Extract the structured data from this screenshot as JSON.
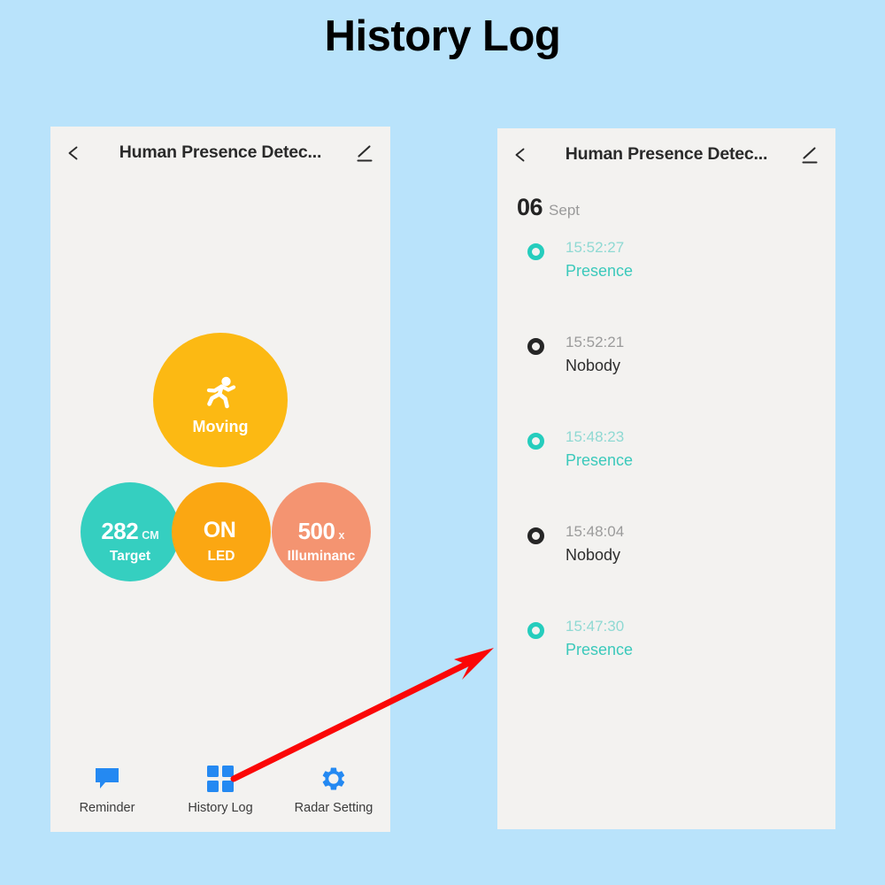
{
  "page": {
    "title": "History Log",
    "background_color": "#b9e3fb"
  },
  "left_phone": {
    "appbar": {
      "back_icon": "chevron-left-icon",
      "title": "Human Presence Detec...",
      "edit_icon": "pencil-edit-icon"
    },
    "status": {
      "icon": "running-person-icon",
      "label": "Moving",
      "color": "#fcb913"
    },
    "metrics": [
      {
        "value": "282",
        "unit": "CM",
        "name": "Target",
        "color": "#35cfc0"
      },
      {
        "value": "ON",
        "unit": "",
        "name": "LED",
        "color": "#fba712"
      },
      {
        "value": "500",
        "unit": "x",
        "name": "Illuminanc",
        "color": "#f49471"
      }
    ],
    "bottom_nav": [
      {
        "icon": "speech-bubble-icon",
        "label": "Reminder"
      },
      {
        "icon": "grid-squares-icon",
        "label": "History Log"
      },
      {
        "icon": "gear-icon",
        "label": "Radar Setting"
      }
    ],
    "nav_icon_color": "#2489f2"
  },
  "right_phone": {
    "appbar": {
      "back_icon": "chevron-left-icon",
      "title": "Human Presence Detec...",
      "edit_icon": "pencil-edit-icon"
    },
    "date": {
      "day": "06",
      "month": "Sept"
    },
    "log_entries": [
      {
        "time": "15:52:27",
        "state": "Presence",
        "type": "presence"
      },
      {
        "time": "15:52:21",
        "state": "Nobody",
        "type": "nobody"
      },
      {
        "time": "15:48:23",
        "state": "Presence",
        "type": "presence"
      },
      {
        "time": "15:48:04",
        "state": "Nobody",
        "type": "nobody"
      },
      {
        "time": "15:47:30",
        "state": "Presence",
        "type": "presence"
      }
    ],
    "colors": {
      "presence": "#3bc9bb",
      "nobody": "#2d2d2d"
    }
  },
  "annotation": {
    "arrow_color": "#fb0707",
    "from": "history-log-nav-icon",
    "to": "history-log-list"
  }
}
